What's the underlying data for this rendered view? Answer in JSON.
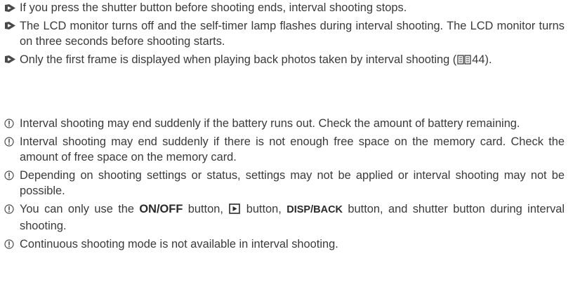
{
  "notes": [
    {
      "text": "If you press the shutter button before shooting ends, interval shooting stops."
    },
    {
      "text": "The LCD monitor turns off and the self-timer lamp flashes during interval shooting. The LCD monitor turns on three seconds before shooting starts."
    },
    {
      "text_before": "Only the first frame is displayed when playing back photos taken by interval shooting (",
      "page_ref": "44",
      "text_after": ")."
    }
  ],
  "cautions": [
    {
      "text": "Interval shooting may end suddenly if the battery runs out. Check the amount of battery remaining."
    },
    {
      "text": "Interval shooting may end suddenly if there is not enough free space on the memory card. Check the amount of free space on the memory card."
    },
    {
      "text": "Depending on shooting settings or status, settings may not be applied or interval shooting may not be possible."
    },
    {
      "part1": "You can only use the ",
      "onoff_label": "ON/OFF",
      "part2": " button, ",
      "part3": " button, ",
      "disp_label": "DISP/BACK",
      "part4": " button, and shutter button during interval shooting."
    },
    {
      "text": "Continuous shooting mode is not available in interval shooting."
    }
  ],
  "icons": {
    "note_marker": "pencil-note-icon",
    "caution_marker": "caution-icon",
    "book_ref": "manual-book-icon",
    "playback": "playback-button-icon"
  },
  "colors": {
    "text": "#3a3a3a",
    "marker": "#4a4a4a"
  }
}
